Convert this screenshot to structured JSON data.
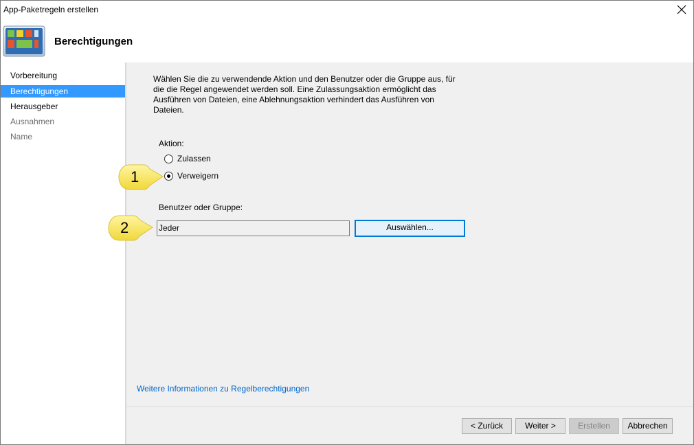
{
  "window": {
    "title": "App-Paketregeln erstellen"
  },
  "header": {
    "heading": "Berechtigungen"
  },
  "sidebar": {
    "items": [
      {
        "label": "Vorbereitung"
      },
      {
        "label": "Berechtigungen"
      },
      {
        "label": "Herausgeber"
      },
      {
        "label": "Ausnahmen"
      },
      {
        "label": "Name"
      }
    ]
  },
  "main": {
    "description": "Wählen Sie die zu verwendende Aktion und den Benutzer oder die Gruppe aus, für die die Regel angewendet werden soll. Eine Zulassungsaktion ermöglicht das Ausführen von Dateien, eine Ablehnungsaktion verhindert das Ausführen von Dateien.",
    "action_label": "Aktion:",
    "action_options": [
      {
        "label": "Zulassen",
        "checked": false
      },
      {
        "label": "Verweigern",
        "checked": true
      }
    ],
    "user_label": "Benutzer oder Gruppe:",
    "user_value": "Jeder",
    "select_button": "Auswählen...",
    "more_info_link": "Weitere Informationen zu Regelberechtigungen"
  },
  "footer": {
    "back_button": "< Zurück",
    "next_button": "Weiter >",
    "create_button": "Erstellen",
    "cancel_button": "Abbrechen"
  },
  "callouts": {
    "one": "1",
    "two": "2"
  },
  "colors": {
    "selection": "#3399ff",
    "link": "#0066cc",
    "callout": "#f7e453",
    "accent": "#0078d7"
  }
}
